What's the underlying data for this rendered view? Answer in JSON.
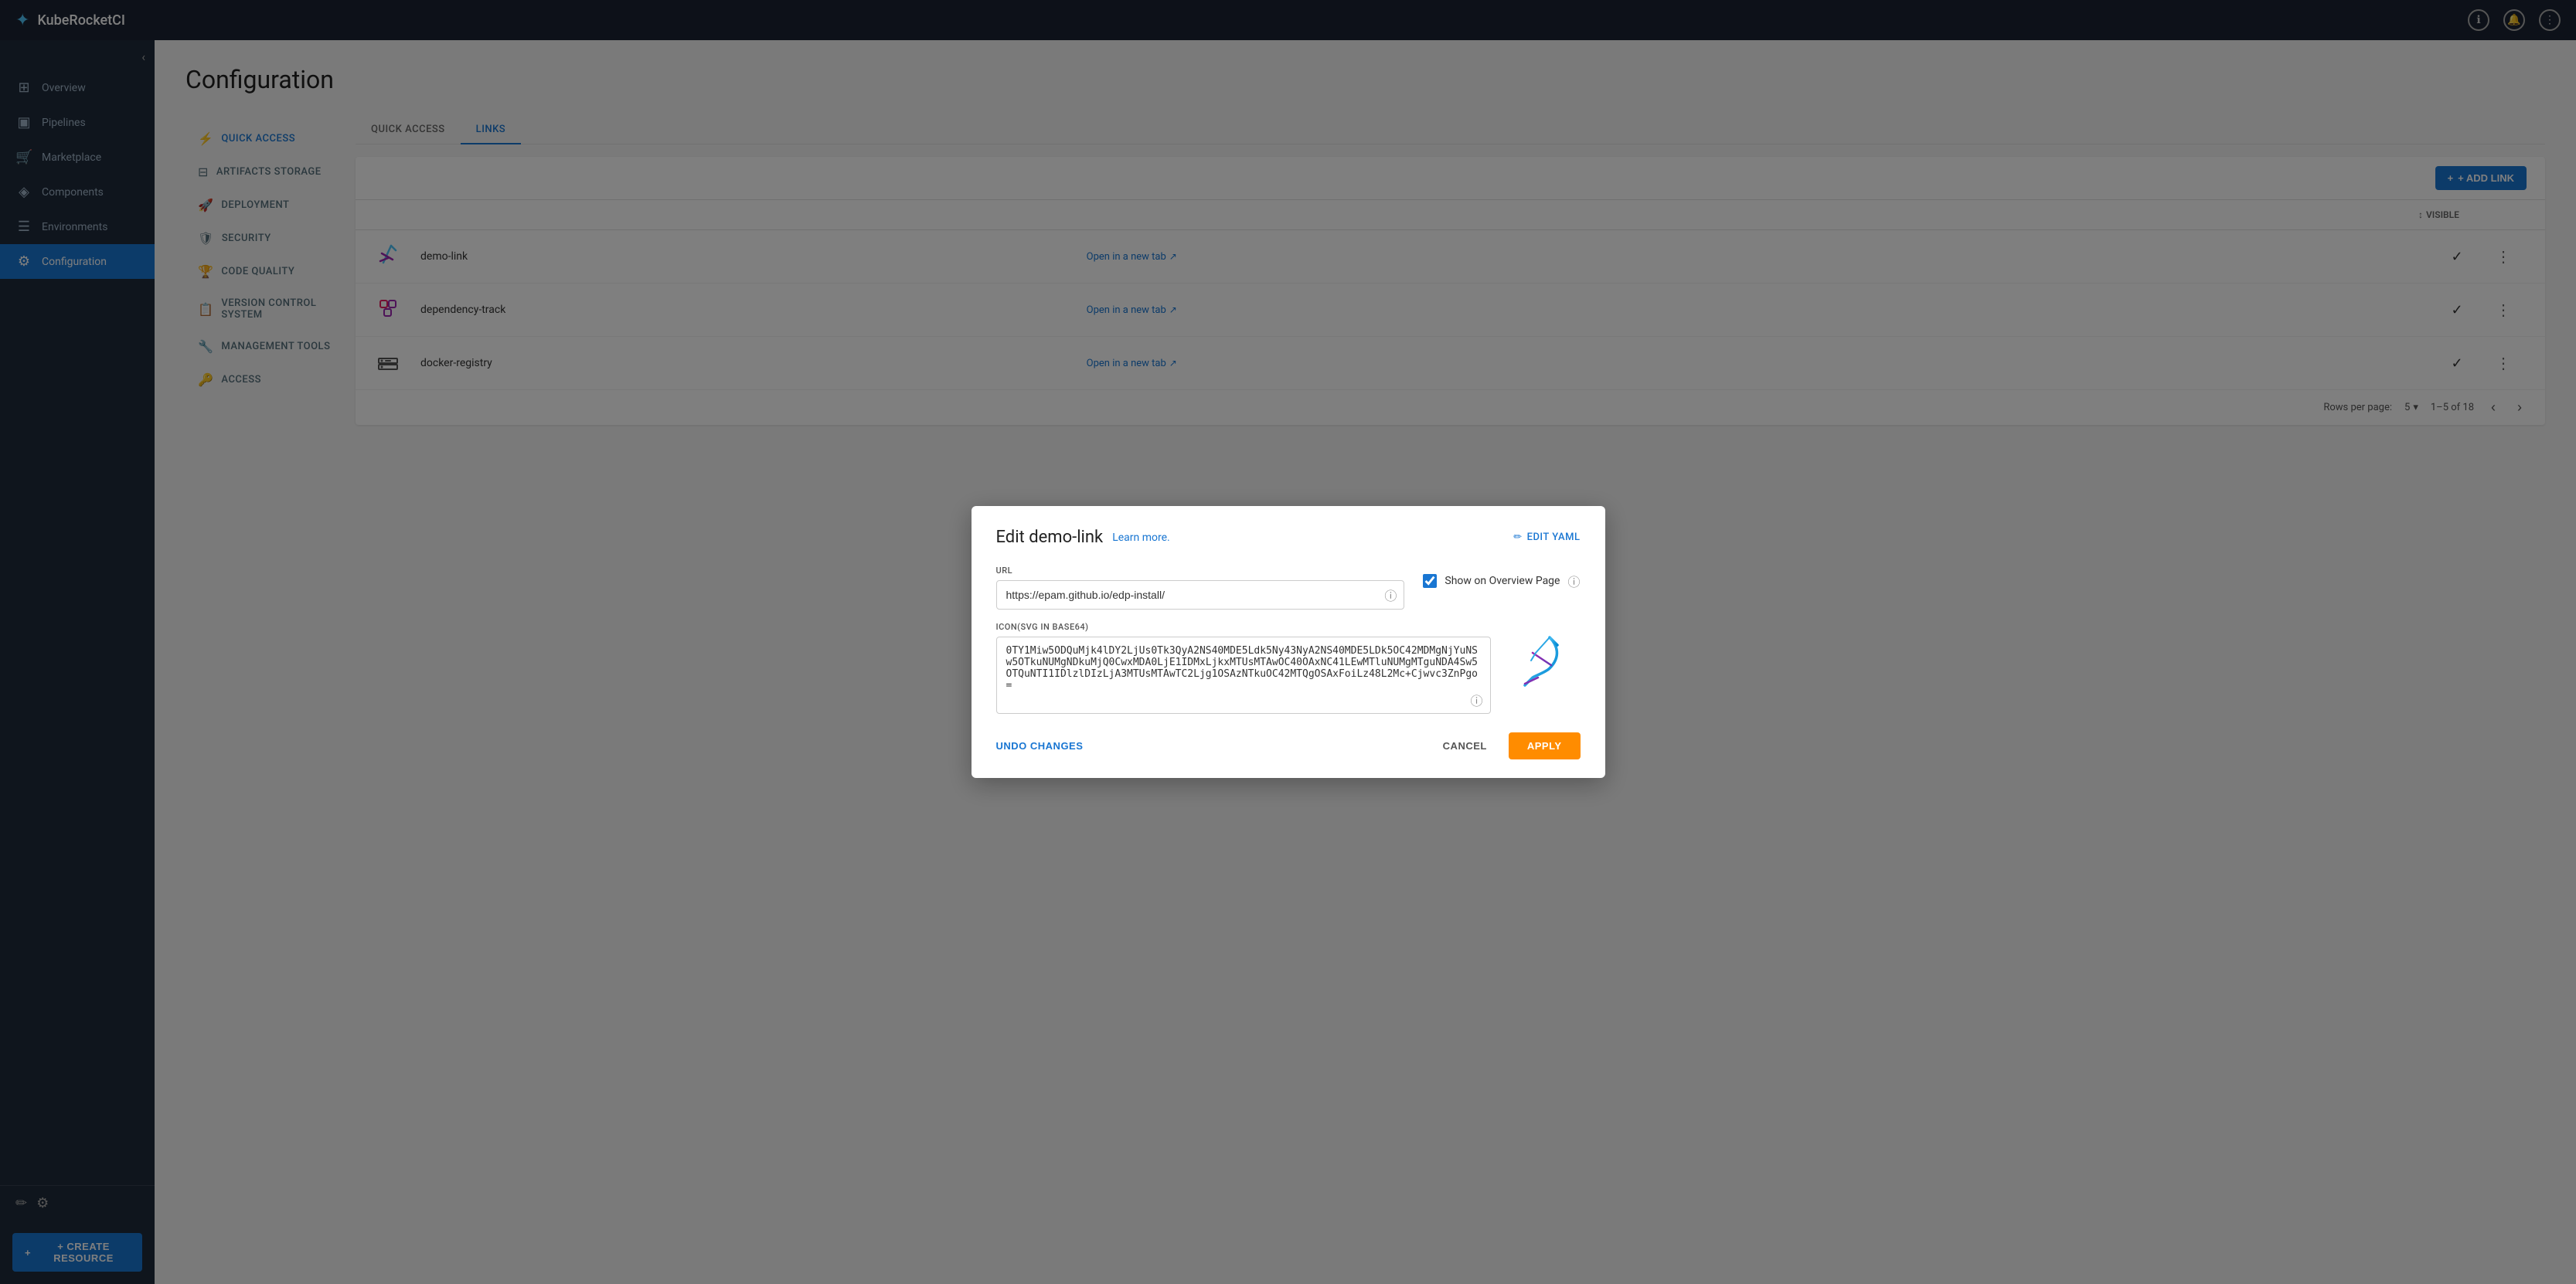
{
  "topbar": {
    "app_name": "KubeRocketCI",
    "logo_icon": "🚀"
  },
  "sidebar": {
    "items": [
      {
        "id": "overview",
        "label": "Overview",
        "icon": "⊞"
      },
      {
        "id": "pipelines",
        "label": "Pipelines",
        "icon": "▣"
      },
      {
        "id": "marketplace",
        "label": "Marketplace",
        "icon": "🛒"
      },
      {
        "id": "components",
        "label": "Components",
        "icon": "◈"
      },
      {
        "id": "environments",
        "label": "Environments",
        "icon": "☰"
      },
      {
        "id": "configuration",
        "label": "Configuration",
        "icon": "⚙",
        "active": true
      }
    ],
    "bottom_icons": [
      "✏",
      "⚙"
    ],
    "create_resource_label": "+ CREATE RESOURCE"
  },
  "config_sidenav": {
    "items": [
      {
        "id": "quick-access",
        "label": "Quick Access",
        "icon": "⚡",
        "active": true
      },
      {
        "id": "artifacts-storage",
        "label": "Artifacts Storage",
        "icon": "⊟"
      },
      {
        "id": "deployment",
        "label": "Deployment",
        "icon": "🚀"
      },
      {
        "id": "security",
        "label": "Security",
        "icon": "🛡"
      },
      {
        "id": "code-quality",
        "label": "Code Quality",
        "icon": "🏆"
      },
      {
        "id": "version-control",
        "label": "Version Control System",
        "icon": "📋"
      },
      {
        "id": "management-tools",
        "label": "Management Tools",
        "icon": "🔧"
      },
      {
        "id": "access",
        "label": "Access",
        "icon": "🔑"
      }
    ]
  },
  "page": {
    "title": "Configuration",
    "tabs": [
      {
        "id": "quick-access",
        "label": "QUICK ACCESS",
        "active": true
      },
      {
        "id": "links",
        "label": "LINKS",
        "active": false
      }
    ],
    "active_tab": "LINKS",
    "add_link_label": "+ ADD LINK"
  },
  "table": {
    "headers": {
      "visible_label": "Visible",
      "visible_icon": "↕"
    },
    "rows": [
      {
        "id": "row1",
        "icon": "feather",
        "name": "demo-link",
        "url_label": "Open in a new tab",
        "visible": true
      },
      {
        "id": "row2",
        "icon": "squares",
        "name": "dependency-track",
        "url_label": "Open in a new tab",
        "visible": true
      },
      {
        "id": "row3",
        "icon": "registry",
        "name": "docker-registry",
        "url_label": "Open in a new tab",
        "visible": true
      }
    ],
    "pagination": {
      "rows_per_page_label": "Rows per page:",
      "rows_per_page_value": "5",
      "range_label": "1–5 of 18"
    }
  },
  "modal": {
    "title": "Edit demo-link",
    "learn_more_label": "Learn more.",
    "edit_yaml_label": "EDIT YAML",
    "url_field_label": "URL",
    "url_value": "https://epam.github.io/edp-install/",
    "show_overview_label": "Show on Overview Page",
    "show_overview_checked": true,
    "icon_field_label": "Icon(svg in base64)",
    "icon_value": "0TY1Miw5ODQuMjk4lDY2LjUs0Tk3QyA2NS40MDE5Ldk5Ny43NyA2NS40MDE5LDk5OC42MDMgNjYuNSw5OTkuNUMgNDkuMjQ0CwxMDA0LjE1IDMxLjkxMTUsMTAwOC40OAxNC41LEwMTluNUMgMTguNDA4Sw5OTQuNTI1IDlzlDIzLjA3MTUsMTAwTC2Ljg1OSAzNTkuOC42MTQgOSAxFoiLz48L2Mc+Cjwvc3ZnPgo=",
    "undo_label": "UNDO CHANGES",
    "cancel_label": "CANCEL",
    "apply_label": "APPLY"
  }
}
